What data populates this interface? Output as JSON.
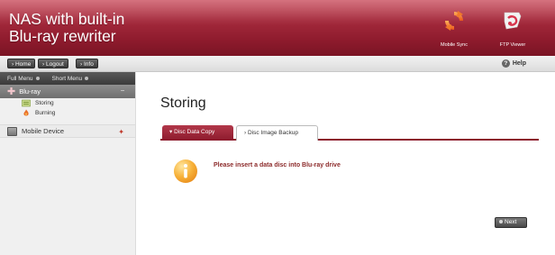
{
  "header": {
    "title_line1": "NAS with built-in",
    "title_line2": "Blu-ray rewriter",
    "mobile_sync_label": "Mobile Sync",
    "ftp_viewer_label": "FTP Viewer",
    "mobile_sync_icon": "sync-icon",
    "ftp_viewer_icon": "ftp-icon"
  },
  "toolbar": {
    "home_label": "› Home",
    "logout_label": "› Logout",
    "info_label": "› Info",
    "help_label": "Help",
    "help_icon": "help-icon"
  },
  "sidebar": {
    "full_menu_label": "Full Menu",
    "short_menu_label": "Short Menu",
    "group_label": "Blu-ray",
    "group_icon": "plus-icon",
    "items": [
      {
        "label": "Storing",
        "icon": "storing-icon"
      },
      {
        "label": "Burning",
        "icon": "burning-icon"
      }
    ],
    "mobile_device_label": "Mobile Device",
    "mobile_device_icon": "mobile-device-icon"
  },
  "main": {
    "title": "Storing",
    "tabs": [
      {
        "label": "▾ Disc Data Copy",
        "active": true
      },
      {
        "label": "› Disc Image Backup",
        "active": false
      }
    ],
    "message": "Please insert a data disc into Blu-ray drive",
    "message_icon": "info-icon",
    "next_label": "Next"
  },
  "colors": {
    "brand": "#8c1a2c",
    "message_text": "#8c2a2a"
  }
}
